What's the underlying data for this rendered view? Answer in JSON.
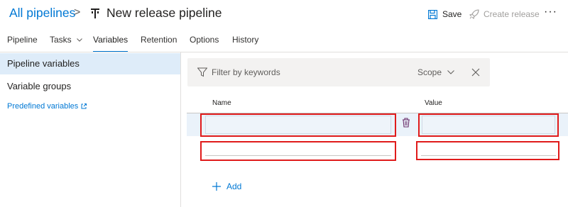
{
  "header": {
    "breadcrumb_root": "All pipelines",
    "breadcrumb_separator": ">",
    "title": "New release pipeline",
    "save_label": "Save",
    "create_release_label": "Create release",
    "more_label": "···"
  },
  "tabs": [
    {
      "label": "Pipeline"
    },
    {
      "label": "Tasks"
    },
    {
      "label": "Variables",
      "active": true
    },
    {
      "label": "Retention"
    },
    {
      "label": "Options"
    },
    {
      "label": "History"
    }
  ],
  "sidebar": {
    "items": [
      {
        "label": "Pipeline variables",
        "selected": true
      },
      {
        "label": "Variable groups"
      }
    ],
    "predefined_link": "Predefined variables"
  },
  "filter": {
    "placeholder": "Filter by keywords",
    "scope_label": "Scope"
  },
  "table": {
    "columns": [
      "Name",
      "Value"
    ],
    "rows": [
      {
        "name": "",
        "value": ""
      },
      {
        "name": "",
        "value": ""
      }
    ]
  },
  "add_label": "Add",
  "colors": {
    "accent": "#0078d4",
    "highlight": "#e01b1b",
    "selected_bg": "#deecf9",
    "disabled_text": "#a19f9d"
  }
}
